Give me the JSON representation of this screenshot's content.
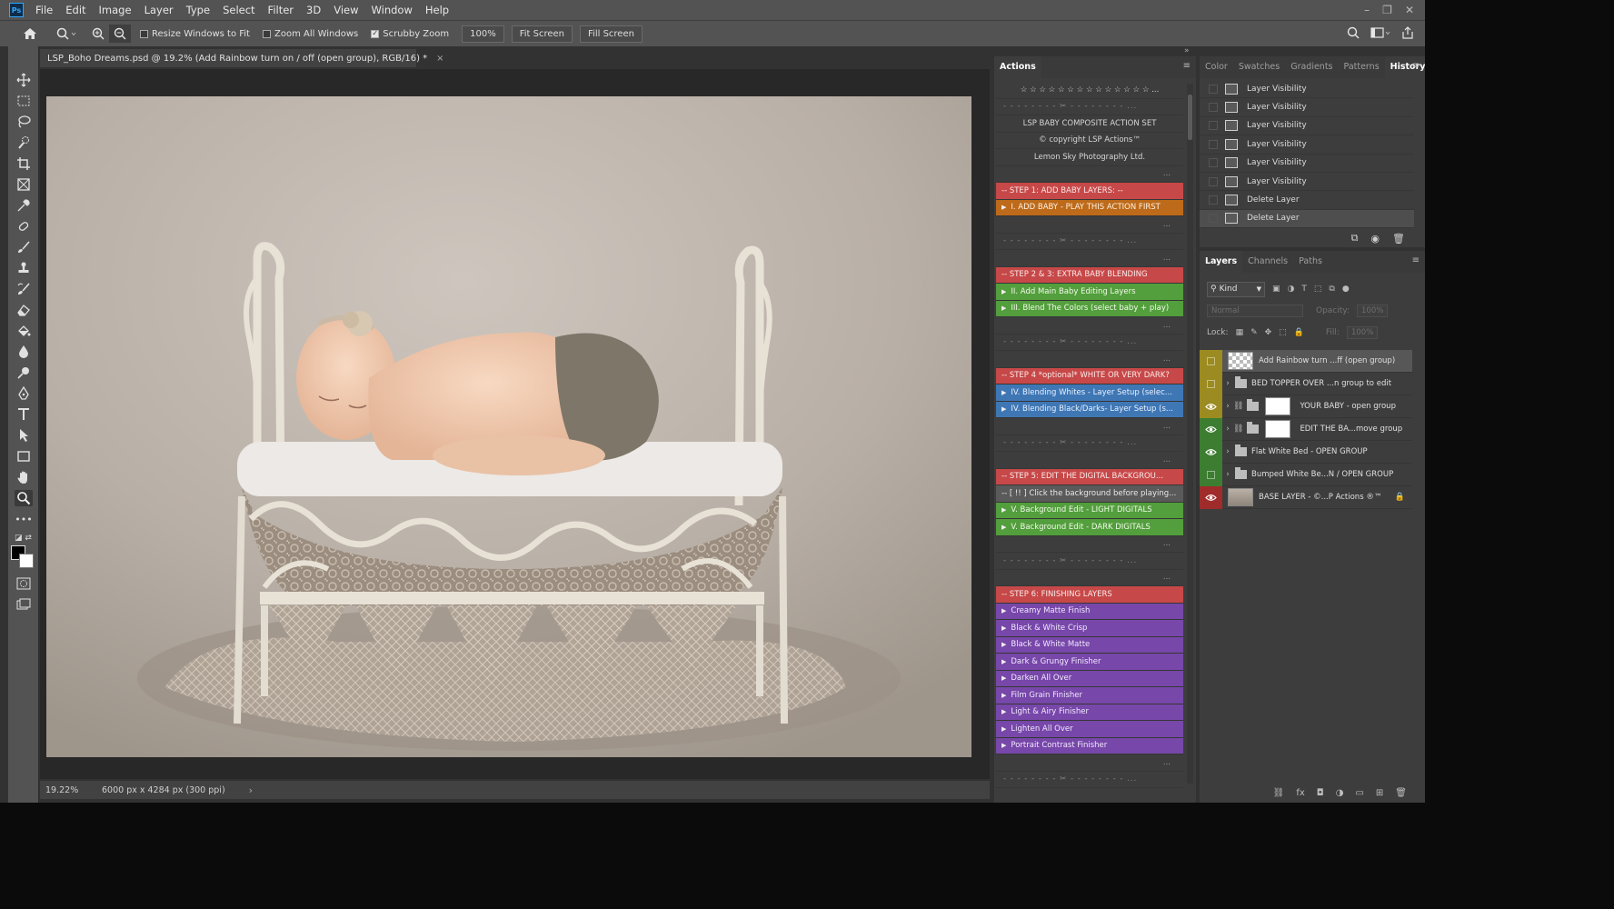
{
  "menubar": {
    "logo": "Ps",
    "items": [
      "File",
      "Edit",
      "Image",
      "Layer",
      "Type",
      "Select",
      "Filter",
      "3D",
      "View",
      "Window",
      "Help"
    ]
  },
  "options_bar": {
    "resize_windows": "Resize Windows to Fit",
    "zoom_all": "Zoom All Windows",
    "scrubby_zoom": "Scrubby Zoom",
    "zoom_value": "100%",
    "fit_screen": "Fit Screen",
    "fill_screen": "Fill Screen",
    "scrubby_checked": true
  },
  "document": {
    "tab_title": "LSP_Boho Dreams.psd @ 19.2% (Add Rainbow turn on / off  (open group), RGB/16) *",
    "close": "×",
    "zoom": "19.22%",
    "size_info": "6000 px x 4284 px (300 ppi)",
    "status_arrow": "›"
  },
  "actions": {
    "tab": "Actions",
    "items": [
      {
        "text": "☆ ☆ ☆ ☆ ☆ ☆ ☆ ☆ ☆ ☆ ☆ ☆ ☆ ☆ ...",
        "style": "center"
      },
      {
        "text": "- - - - - - - - ✂ - - - - - - - - ...",
        "style": "dash"
      },
      {
        "text": "LSP BABY COMPOSITE ACTION SET",
        "style": "center"
      },
      {
        "text": "© copyright LSP Actions™",
        "style": "center"
      },
      {
        "text": "Lemon Sky Photography Ltd.",
        "style": "center"
      },
      {
        "text": "...",
        "style": "dots"
      },
      {
        "text": "-- STEP 1: ADD BABY LAYERS: --",
        "style": "c-red"
      },
      {
        "text": "I. ADD BABY - PLAY THIS ACTION FIRST",
        "style": "c-orange",
        "arrow": true
      },
      {
        "text": "...",
        "style": "dots"
      },
      {
        "text": "- - - - - - - - ✂ - - - - - - - - ...",
        "style": "dash"
      },
      {
        "text": "...",
        "style": "dots"
      },
      {
        "text": "-- STEP 2 & 3: EXTRA BABY BLENDING",
        "style": "c-red"
      },
      {
        "text": "II.  Add Main Baby Editing Layers",
        "style": "c-green",
        "arrow": true
      },
      {
        "text": "III. Blend The Colors (select baby + play)",
        "style": "c-green",
        "arrow": true
      },
      {
        "text": "...",
        "style": "dots"
      },
      {
        "text": "- - - - - - - - ✂ - - - - - - - - ...",
        "style": "dash"
      },
      {
        "text": "...",
        "style": "dots"
      },
      {
        "text": "-- STEP 4 *optional* WHITE OR VERY DARK?",
        "style": "c-red"
      },
      {
        "text": "IV. Blending Whites - Layer Setup (selec...",
        "style": "c-blue",
        "arrow": true
      },
      {
        "text": "IV. Blending Black/Darks- Layer Setup (s...",
        "style": "c-blue",
        "arrow": true
      },
      {
        "text": "...",
        "style": "dots"
      },
      {
        "text": "- - - - - - - - ✂ - - - - - - - - ...",
        "style": "dash"
      },
      {
        "text": "...",
        "style": "dots"
      },
      {
        "text": "-- STEP 5: EDIT THE DIGITAL BACKGROU...",
        "style": "c-red"
      },
      {
        "text": "-- [ !! ] Click the background before playing...",
        "style": "c-gray"
      },
      {
        "text": "V. Background Edit - LIGHT DIGITALS",
        "style": "c-green",
        "arrow": true
      },
      {
        "text": "V. Background Edit - DARK DIGITALS",
        "style": "c-green",
        "arrow": true
      },
      {
        "text": "...",
        "style": "dots"
      },
      {
        "text": "- - - - - - - - ✂ - - - - - - - - ...",
        "style": "dash"
      },
      {
        "text": "...",
        "style": "dots"
      },
      {
        "text": "-- STEP 6: FINISHING LAYERS",
        "style": "c-red"
      },
      {
        "text": "Creamy Matte Finish",
        "style": "c-purple",
        "arrow": true
      },
      {
        "text": "Black & White Crisp",
        "style": "c-purple",
        "arrow": true
      },
      {
        "text": "Black & White Matte",
        "style": "c-purple",
        "arrow": true
      },
      {
        "text": "Dark & Grungy Finisher",
        "style": "c-purple",
        "arrow": true
      },
      {
        "text": "Darken All Over",
        "style": "c-purple",
        "arrow": true
      },
      {
        "text": "Film Grain Finisher",
        "style": "c-purple",
        "arrow": true
      },
      {
        "text": "Light & Airy Finisher",
        "style": "c-purple",
        "arrow": true
      },
      {
        "text": "Lighten All Over",
        "style": "c-purple",
        "arrow": true
      },
      {
        "text": "Portrait Contrast Finisher",
        "style": "c-purple",
        "arrow": true
      },
      {
        "text": "...",
        "style": "dots"
      },
      {
        "text": "- - - - - - - - ✂ - - - - - - - - ...",
        "style": "dash"
      }
    ]
  },
  "history": {
    "tabs": [
      "Color",
      "Swatches",
      "Gradients",
      "Patterns",
      "History"
    ],
    "items": [
      "Layer Visibility",
      "Layer Visibility",
      "Layer Visibility",
      "Layer Visibility",
      "Layer Visibility",
      "Layer Visibility",
      "Delete Layer",
      "Delete Layer"
    ]
  },
  "layers": {
    "tabs": [
      "Layers",
      "Channels",
      "Paths"
    ],
    "kind": "Kind",
    "blend_mode": "Normal",
    "opacity_label": "Opacity:",
    "opacity_value": "100%",
    "lock_label": "Lock:",
    "fill_label": "Fill:",
    "fill_value": "100%",
    "rows": [
      {
        "name": "Add Rainbow turn ...ff  (open group)",
        "vis": "yellow",
        "eye": false,
        "type": "layer",
        "thumb": "check",
        "sel": true
      },
      {
        "name": "BED TOPPER OVER ...n group to edit",
        "vis": "yellow",
        "eye": false,
        "type": "folder"
      },
      {
        "name": "YOUR BABY - open group",
        "vis": "yellow",
        "eye": true,
        "type": "folder-mask"
      },
      {
        "name": "EDIT THE BA...move group",
        "vis": "green",
        "eye": true,
        "type": "folder-mask"
      },
      {
        "name": "Flat White Bed - OPEN GROUP",
        "vis": "green",
        "eye": true,
        "type": "folder"
      },
      {
        "name": "Bumped White Be...N / OPEN GROUP",
        "vis": "green",
        "eye": false,
        "type": "folder"
      },
      {
        "name": "BASE LAYER - ©...P Actions ®™",
        "vis": "red",
        "eye": true,
        "type": "layer",
        "thumb": "photo",
        "lock": true
      }
    ]
  }
}
